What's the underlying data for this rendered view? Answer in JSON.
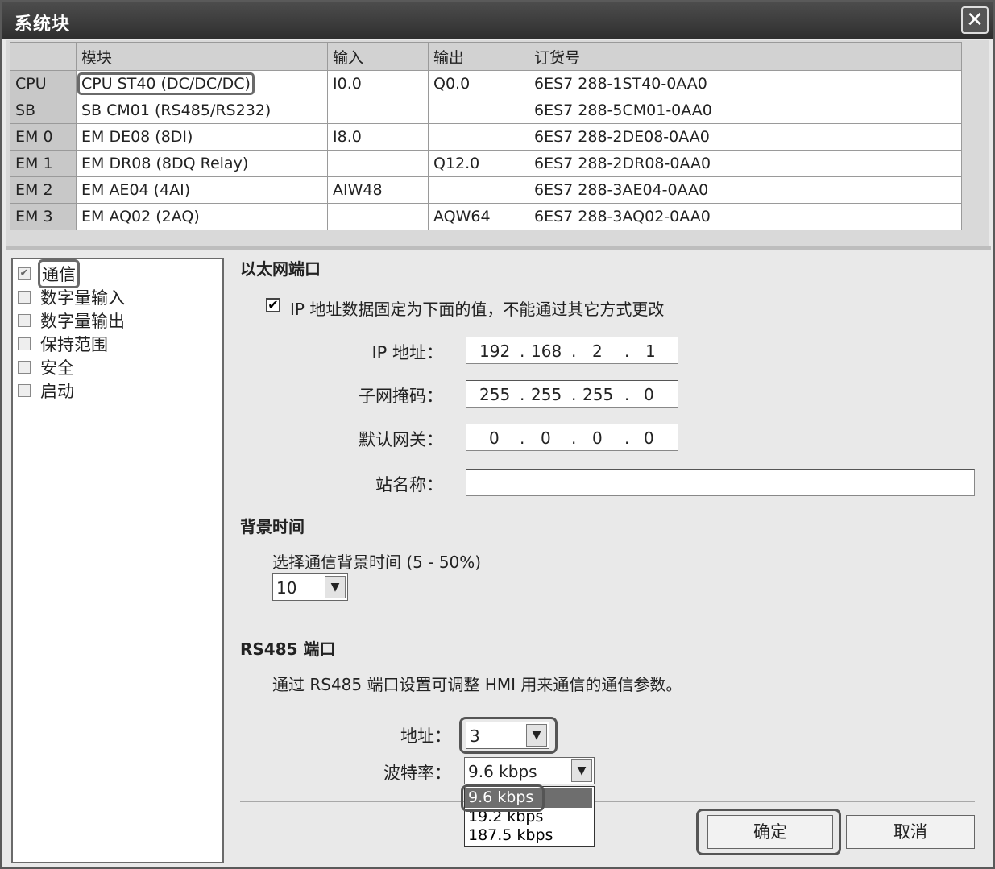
{
  "window": {
    "title": "系统块"
  },
  "modules": {
    "headers": [
      "",
      "模块",
      "输入",
      "输出",
      "订货号"
    ],
    "rows": [
      [
        "CPU",
        "CPU ST40 (DC/DC/DC)",
        "I0.0",
        "Q0.0",
        "6ES7 288-1ST40-0AA0"
      ],
      [
        "SB",
        "SB CM01 (RS485/RS232)",
        "",
        "",
        "6ES7 288-5CM01-0AA0"
      ],
      [
        "EM 0",
        "EM DE08 (8DI)",
        "I8.0",
        "",
        "6ES7 288-2DE08-0AA0"
      ],
      [
        "EM 1",
        "EM DR08 (8DQ Relay)",
        "",
        "Q12.0",
        "6ES7 288-2DR08-0AA0"
      ],
      [
        "EM 2",
        "EM AE04 (4AI)",
        "AIW48",
        "",
        "6ES7 288-3AE04-0AA0"
      ],
      [
        "EM 3",
        "EM AQ02 (2AQ)",
        "",
        "AQW64",
        "6ES7 288-3AQ02-0AA0"
      ]
    ]
  },
  "tree": {
    "items": [
      "通信",
      "数字量输入",
      "数字量输出",
      "保持范围",
      "安全",
      "启动"
    ]
  },
  "ethernet": {
    "section_title": "以太网端口",
    "fixed_ip_label": "IP 地址数据固定为下面的值，不能通过其它方式更改",
    "ip_label": "IP 地址：",
    "ip": [
      "192",
      "168",
      "2",
      "1"
    ],
    "mask_label": "子网掩码：",
    "mask": [
      "255",
      "255",
      "255",
      "0"
    ],
    "gateway_label": "默认网关：",
    "gateway": [
      "0",
      "0",
      "0",
      "0"
    ],
    "station_label": "站名称：",
    "station_value": "",
    "dot": "."
  },
  "background": {
    "section_title": "背景时间",
    "label": "选择通信背景时间 (5 - 50%)",
    "value": "10"
  },
  "rs485": {
    "section_title": "RS485 端口",
    "description": "通过 RS485 端口设置可调整 HMI 用来通信的通信参数。",
    "address_label": "地址：",
    "address_value": "3",
    "baud_label": "波特率：",
    "baud_value": "9.6 kbps",
    "baud_options": [
      "9.6 kbps",
      "19.2 kbps",
      "187.5 kbps"
    ]
  },
  "buttons": {
    "ok": "确定",
    "cancel": "取消"
  },
  "icons": {
    "close": "close-icon",
    "dropdown_arrow": "▼",
    "check": "✔"
  }
}
